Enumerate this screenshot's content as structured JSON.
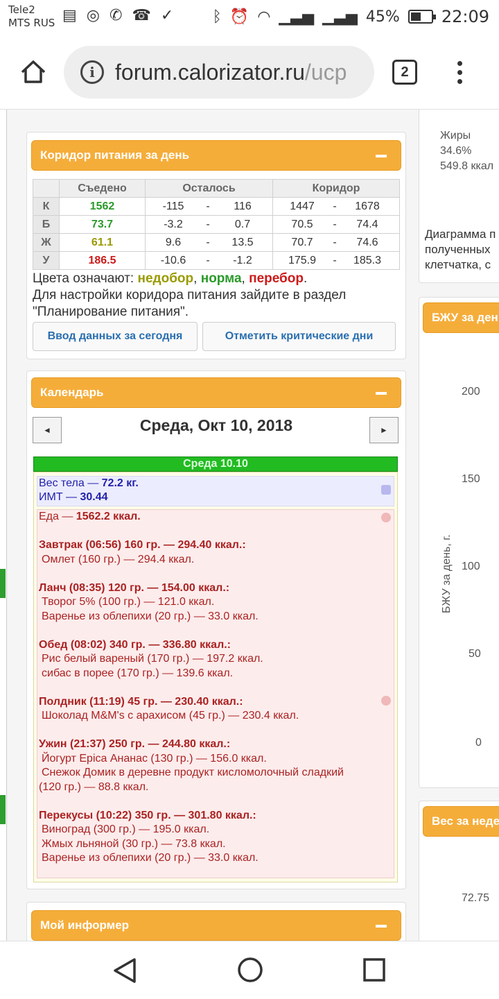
{
  "status": {
    "carrier1": "Tele2",
    "carrier2": "MTS RUS",
    "battery": "45%",
    "time": "22:09"
  },
  "browser": {
    "url_host": "forum.calorizator.ru",
    "url_path": "/ucp",
    "tab_count": "2"
  },
  "corridor": {
    "title": "Коридор питания за день",
    "headers": [
      "",
      "Съедено",
      "Осталось",
      "Коридор"
    ],
    "rows": [
      {
        "label": "К",
        "eaten": "1562",
        "eaten_color": "#2a9a2a",
        "rem_from": "-115",
        "rem_to": "116",
        "cor_from": "1447",
        "cor_to": "1678"
      },
      {
        "label": "Б",
        "eaten": "73.7",
        "eaten_color": "#2a9a2a",
        "rem_from": "-3.2",
        "rem_to": "0.7",
        "cor_from": "70.5",
        "cor_to": "74.4"
      },
      {
        "label": "Ж",
        "eaten": "61.1",
        "eaten_color": "#9a9a00",
        "rem_from": "9.6",
        "rem_to": "13.5",
        "cor_from": "70.7",
        "cor_to": "74.6"
      },
      {
        "label": "У",
        "eaten": "186.5",
        "eaten_color": "#cc1a1a",
        "rem_from": "-10.6",
        "rem_to": "-1.2",
        "cor_from": "175.9",
        "cor_to": "185.3"
      }
    ],
    "dash": "-",
    "legend_prefix": "Цвета означают: ",
    "legend_under": "недобор",
    "legend_sep1": ", ",
    "legend_norm": "норма",
    "legend_sep2": ", ",
    "legend_over": "перебор",
    "legend_end": ".",
    "legend_note": "Для настройки коридора питания зайдите в раздел \"Планирование питания\".",
    "btn_enter": "Ввод данных за сегодня",
    "btn_critical": "Отметить критические дни"
  },
  "calendar": {
    "title": "Календарь",
    "prev": "◄",
    "next": "►",
    "date": "Среда, Окт 10, 2018",
    "day_label": "Среда 10.10",
    "weight_text": "Вес тела — ",
    "weight_value": "72.2 кг.",
    "bmi_text": "ИМТ — ",
    "bmi_value": "30.44",
    "food_text": "Еда — ",
    "food_value": "1562.2 ккал.",
    "meals": [
      {
        "title": "Завтрак (06:56) 160 гр. — 294.40 ккал.:",
        "items": [
          "Омлет (160 гр.) — 294.4 ккал."
        ]
      },
      {
        "title": "Ланч (08:35) 120 гр. — 154.00 ккал.:",
        "items": [
          "Творог 5% (100 гр.) — 121.0 ккал.",
          "Варенье из облепихи (20 гр.) — 33.0 ккал."
        ]
      },
      {
        "title": "Обед (08:02) 340 гр. — 336.80 ккал.:",
        "items": [
          "Рис белый вареный (170 гр.) — 197.2 ккал.",
          "сибас в порее (170 гр.) — 139.6 ккал."
        ]
      },
      {
        "title": "Полдник (11:19) 45 гр. — 230.40 ккал.:",
        "items": [
          "Шоколад M&M's с арахисом (45 гр.) — 230.4 ккал."
        ]
      },
      {
        "title": "Ужин (21:37) 250 гр. — 244.80 ккал.:",
        "items": [
          "Йогурт Epica Ананас (130 гр.) — 156.0 ккал.",
          "Снежок Домик в деревне продукт кисломолочный сладкий",
          "(120 гр.) — 88.8 ккал."
        ]
      },
      {
        "title": "Перекусы (10:22) 350 гр. — 301.80 ккал.:",
        "items": [
          "Виноград (300 гр.) — 195.0 ккал.",
          "Жмых льняной (30 гр.) — 73.8 ккал.",
          "Варенье из облепихи (20 гр.) — 33.0 ккал."
        ]
      }
    ]
  },
  "informer": {
    "title": "Мой информер"
  },
  "right": {
    "fat_label": "Жиры",
    "fat_pct": "34.6%",
    "fat_kcal": "549.8 ккал",
    "diagram_text": [
      "Диаграмма п",
      "полученных",
      "клетчатка, с"
    ],
    "bju_title": "БЖУ за ден",
    "bju_ylabel": "БЖУ за день, г.",
    "bju_ticks": [
      "200",
      "150",
      "100",
      "50",
      "0"
    ],
    "weight_title": "Вес за неде",
    "weight_tick": "72.75"
  }
}
